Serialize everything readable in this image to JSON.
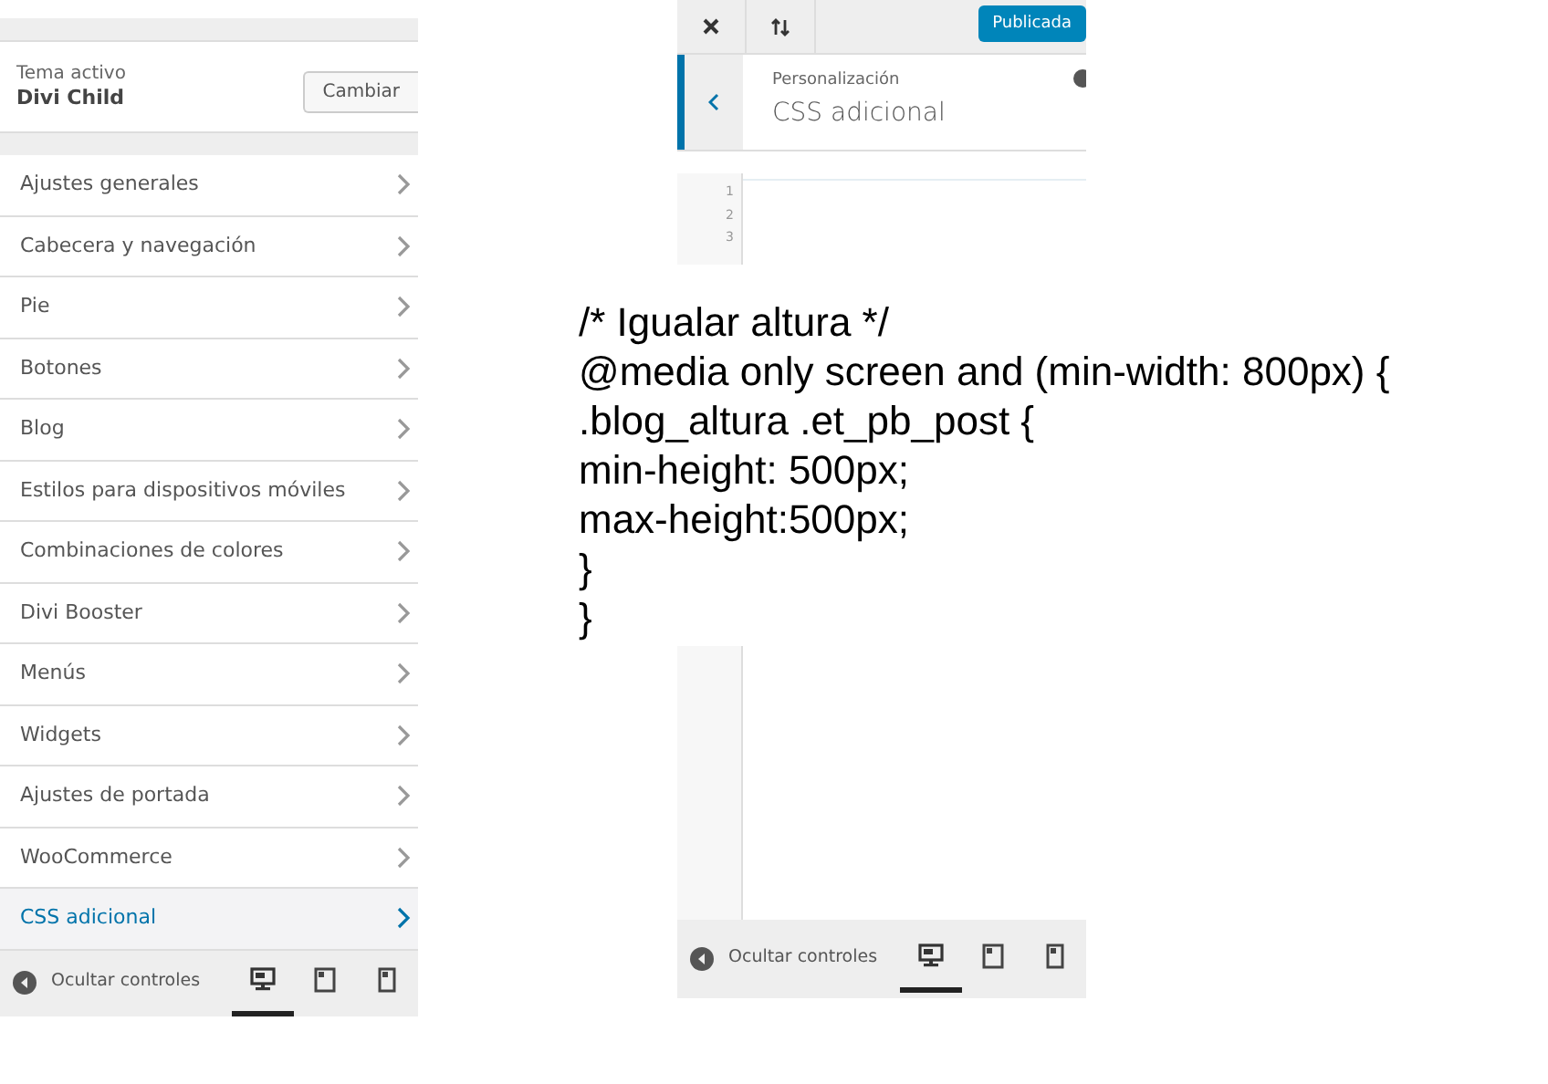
{
  "left_panel": {
    "active_theme": {
      "label": "Tema activo",
      "name": "Divi Child",
      "button": "Cambiar"
    },
    "menu": [
      {
        "label": "Ajustes generales",
        "selected": false
      },
      {
        "label": "Cabecera y navegación",
        "selected": false
      },
      {
        "label": "Pie",
        "selected": false
      },
      {
        "label": "Botones",
        "selected": false
      },
      {
        "label": "Blog",
        "selected": false
      },
      {
        "label": "Estilos para dispositivos móviles",
        "selected": false
      },
      {
        "label": "Combinaciones de colores",
        "selected": false
      },
      {
        "label": "Divi Booster",
        "selected": false
      },
      {
        "label": "Menús",
        "selected": false
      },
      {
        "label": "Widgets",
        "selected": false
      },
      {
        "label": "Ajustes de portada",
        "selected": false
      },
      {
        "label": "WooCommerce",
        "selected": false
      },
      {
        "label": "CSS adicional",
        "selected": true
      }
    ],
    "footer": {
      "label": "Ocultar controles",
      "devices": [
        {
          "kind": "desktop",
          "selected": true
        },
        {
          "kind": "tablet",
          "selected": false
        },
        {
          "kind": "mobile",
          "selected": false
        }
      ]
    }
  },
  "right_panel_top": {
    "publish_button": "Publicada",
    "section": {
      "breadcrumb": "Personalización",
      "title": "CSS adicional"
    },
    "line_numbers": [
      "1",
      "2",
      "3"
    ]
  },
  "code_overlay": [
    "/* Igualar altura */",
    "@media only screen and (min-width: 800px) {",
    ".blog_altura .et_pb_post {",
    "min-height: 500px;",
    "max-height:500px;",
    "}",
    "}"
  ],
  "right_panel_bottom": {
    "footer": {
      "label": "Ocultar controles",
      "devices": [
        {
          "kind": "desktop",
          "selected": true
        },
        {
          "kind": "tablet",
          "selected": false
        },
        {
          "kind": "mobile",
          "selected": false
        }
      ]
    }
  }
}
